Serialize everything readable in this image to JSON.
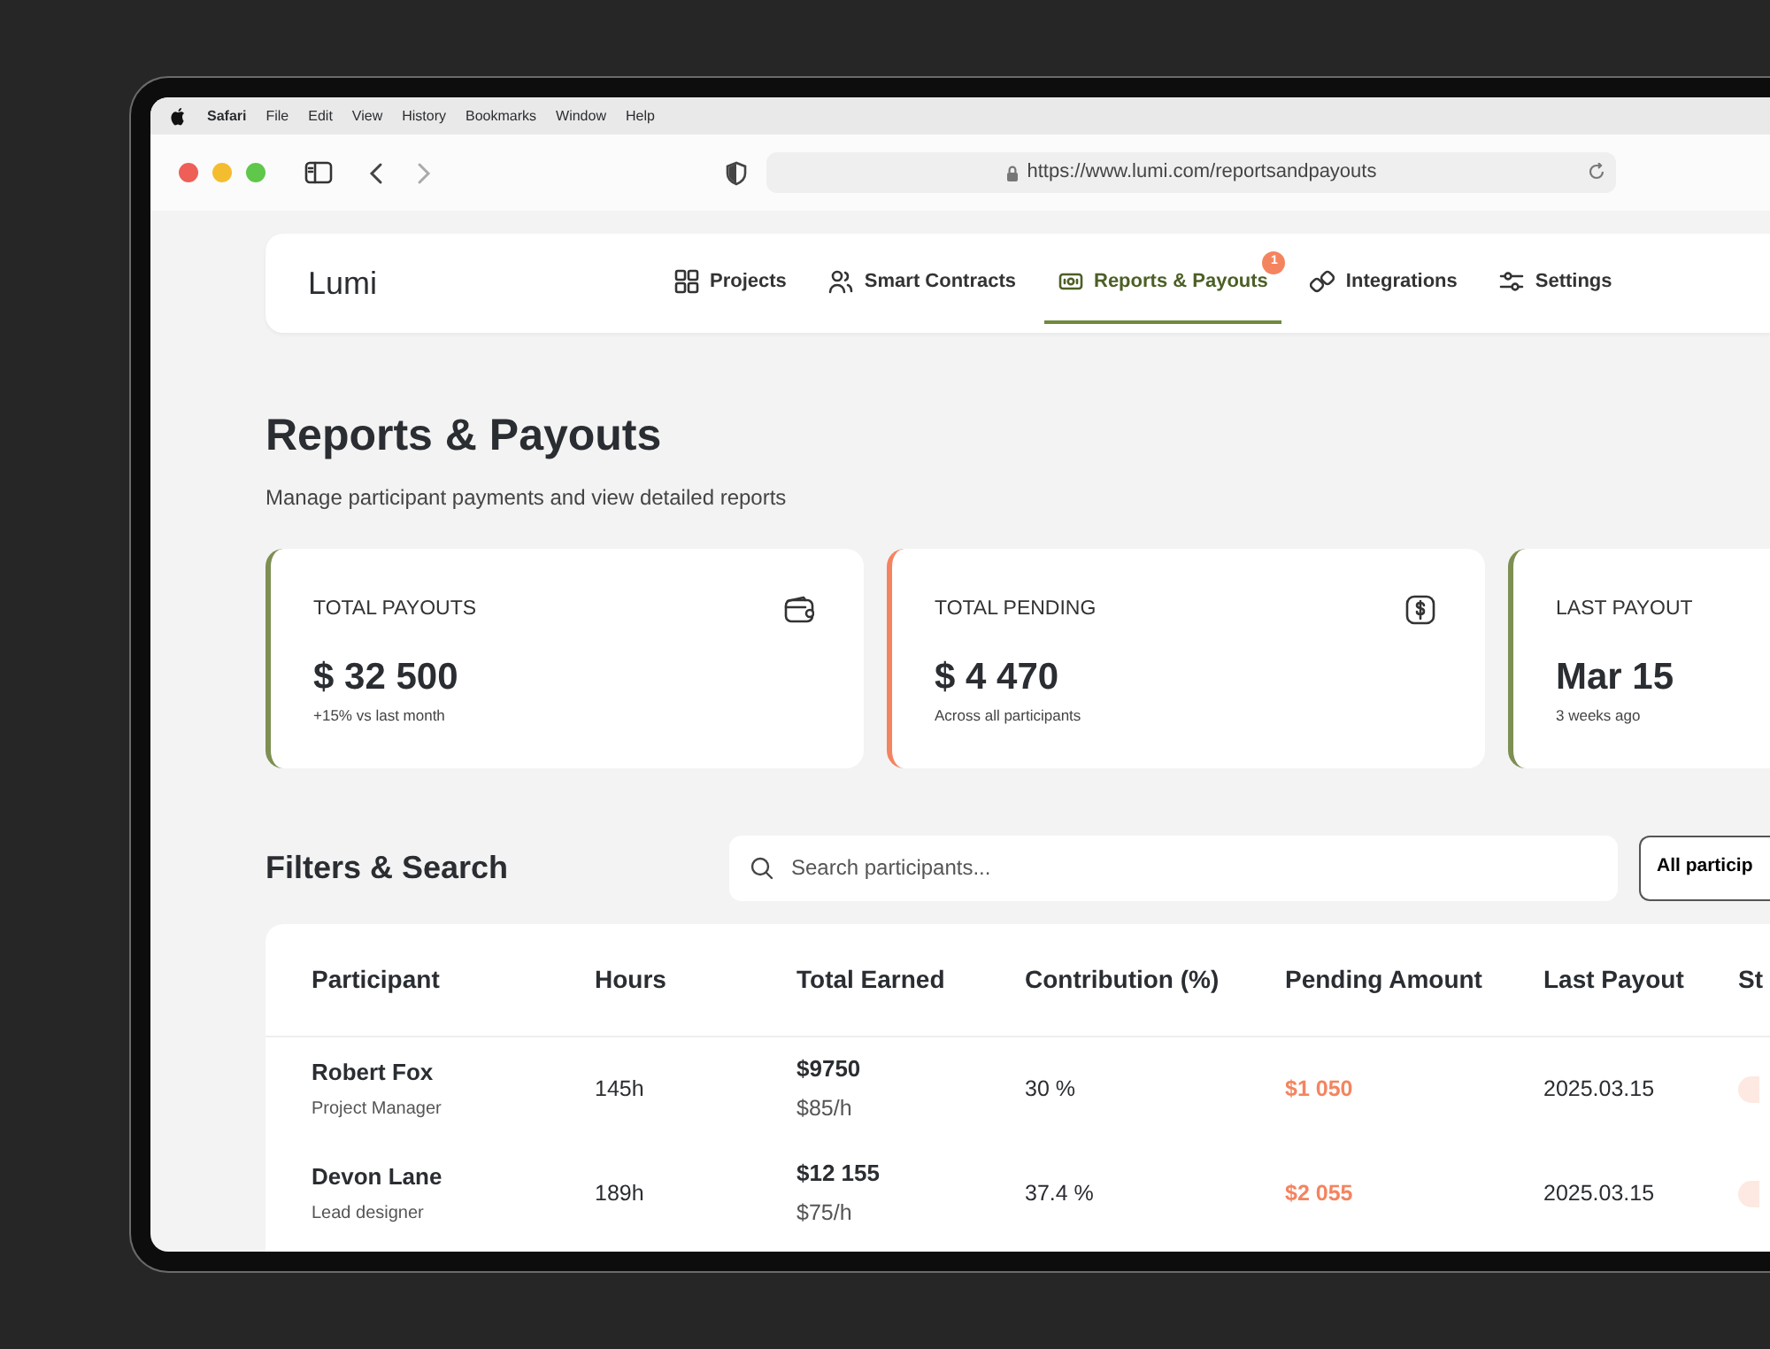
{
  "menubar": {
    "app": "Safari",
    "items": [
      "File",
      "Edit",
      "View",
      "History",
      "Bookmarks",
      "Window",
      "Help"
    ]
  },
  "browser": {
    "url": "https://www.lumi.com/reportsandpayouts"
  },
  "app": {
    "logo": "Lumi",
    "nav": [
      {
        "label": "Projects",
        "selected": false
      },
      {
        "label": "Smart Contracts",
        "selected": false
      },
      {
        "label": "Reports & Payouts",
        "selected": true,
        "badge": "1"
      },
      {
        "label": "Integrations",
        "selected": false
      },
      {
        "label": "Settings",
        "selected": false
      }
    ]
  },
  "page": {
    "title": "Reports & Payouts",
    "subtitle": "Manage participant payments and view detailed reports"
  },
  "stats": [
    {
      "label": "TOTAL PAYOUTS",
      "value": "$ 32 500",
      "note": "+15% vs last month",
      "color": "#7d8f52"
    },
    {
      "label": "TOTAL PENDING",
      "value": "$ 4 470",
      "note": "Across all participants",
      "color": "#f4845f"
    },
    {
      "label": "LAST PAYOUT",
      "value": "Mar 15",
      "note": "3 weeks ago",
      "color": "#7d8f52"
    }
  ],
  "filters": {
    "title": "Filters & Search",
    "search": {
      "placeholder": "Search participants..."
    },
    "dropdown": "All particip"
  },
  "table": {
    "columns": [
      "Participant",
      "Hours",
      "Total Earned",
      "Contribution (%)",
      "Pending Amount",
      "Last Payout",
      "St"
    ],
    "rows": [
      {
        "participant": "Robert Fox",
        "role": "Project Manager",
        "hours": "145h",
        "earned": "$9750",
        "rate": "$85/h",
        "contribution": "30 %",
        "pending": "$1 050",
        "last_payout": "2025.03.15",
        "status_badge": true
      },
      {
        "participant": "Devon Lane",
        "role": "Lead designer",
        "hours": "189h",
        "earned": "$12 155",
        "rate": "$75/h",
        "contribution": "37.4 %",
        "pending": "$2 055",
        "last_payout": "2025.03.15",
        "status_badge": true
      }
    ]
  }
}
